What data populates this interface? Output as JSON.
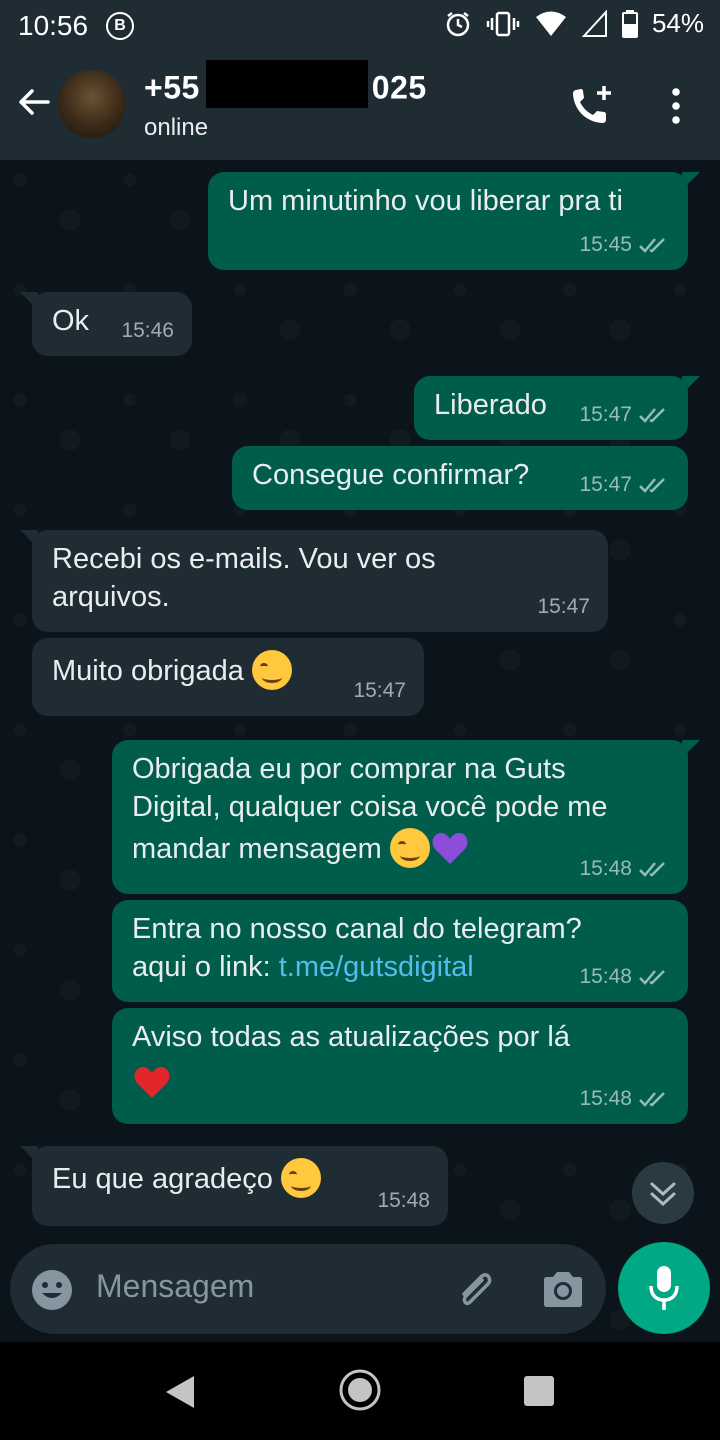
{
  "status_bar": {
    "time": "10:56",
    "b_icon": "B",
    "battery": "54%",
    "icons": [
      "alarm-icon",
      "vibrate-icon",
      "wifi-icon",
      "signal-icon",
      "battery-icon"
    ]
  },
  "header": {
    "name_prefix": "+55",
    "name_suffix": "025",
    "status": "online",
    "icons": [
      "back-arrow-icon",
      "add-call-icon",
      "more-vert-icon"
    ]
  },
  "messages": [
    {
      "dir": "out",
      "text": "Um minutinho vou liberar pra ti",
      "time": "15:45"
    },
    {
      "dir": "in",
      "text": "Ok",
      "time": "15:46"
    },
    {
      "dir": "out",
      "text": "Liberado",
      "time": "15:47"
    },
    {
      "dir": "out",
      "text": "Consegue confirmar?",
      "time": "15:47"
    },
    {
      "dir": "in",
      "text_line1": "Recebi os e-mails. Vou ver os",
      "text_line2": "arquivos.",
      "time": "15:47"
    },
    {
      "dir": "in",
      "text": "Muito obrigada",
      "time": "15:47"
    },
    {
      "dir": "out",
      "text_line1": "Obrigada eu por comprar na Guts",
      "text_line2": "Digital, qualquer coisa você pode me",
      "text_line3": "mandar mensagem",
      "time": "15:48"
    },
    {
      "dir": "out",
      "text_line1": "Entra no nosso canal do telegram?",
      "text_line2": "aqui o link: ",
      "link": "t.me/gutsdigital",
      "time": "15:48"
    },
    {
      "dir": "out",
      "text": "Aviso todas as atualizações por lá",
      "time": "15:48"
    },
    {
      "dir": "in",
      "text": "Eu que agradeço",
      "time": "15:48"
    }
  ],
  "input": {
    "placeholder": "Mensagem"
  },
  "colors": {
    "outgoing_bubble": "#005c4b",
    "incoming_bubble": "#1f2c34",
    "accent": "#00a884",
    "link": "#53bdeb"
  }
}
